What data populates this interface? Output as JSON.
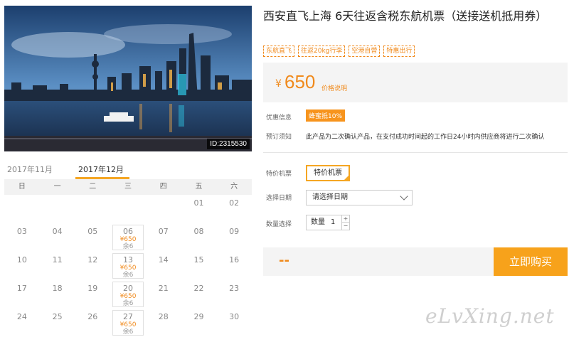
{
  "photo": {
    "id_label": "ID:2315530"
  },
  "calendar": {
    "tabs": [
      "2017年11月",
      "2017年12月"
    ],
    "active_tab": 1,
    "weekdays": [
      "日",
      "一",
      "二",
      "三",
      "四",
      "五",
      "六"
    ],
    "weeks": [
      [
        {
          "d": ""
        },
        {
          "d": ""
        },
        {
          "d": ""
        },
        {
          "d": ""
        },
        {
          "d": ""
        },
        {
          "d": "01"
        },
        {
          "d": "02"
        }
      ],
      [
        {
          "d": "03"
        },
        {
          "d": "04"
        },
        {
          "d": "05"
        },
        {
          "d": "06",
          "price": "¥650",
          "remain": "余6"
        },
        {
          "d": "07"
        },
        {
          "d": "08"
        },
        {
          "d": "09"
        }
      ],
      [
        {
          "d": "10"
        },
        {
          "d": "11"
        },
        {
          "d": "12"
        },
        {
          "d": "13",
          "price": "¥650",
          "remain": "余6"
        },
        {
          "d": "14"
        },
        {
          "d": "15"
        },
        {
          "d": "16"
        }
      ],
      [
        {
          "d": "17"
        },
        {
          "d": "18"
        },
        {
          "d": "19"
        },
        {
          "d": "20",
          "price": "¥650",
          "remain": "余6"
        },
        {
          "d": "21"
        },
        {
          "d": "22"
        },
        {
          "d": "23"
        }
      ],
      [
        {
          "d": "24"
        },
        {
          "d": "25"
        },
        {
          "d": "26"
        },
        {
          "d": "27",
          "price": "¥650",
          "remain": "余6"
        },
        {
          "d": "28"
        },
        {
          "d": "29"
        },
        {
          "d": "30"
        }
      ]
    ]
  },
  "product": {
    "title": "西安直飞上海 6天往返含税东航机票（送接送机抵用券）",
    "tags": [
      "东航直飞",
      "往返20kg行李",
      "空港自营",
      "特惠出行"
    ],
    "price_symbol": "¥",
    "price": "650",
    "price_note": "价格说明",
    "promo_label": "优惠信息",
    "promo_badge": "蜂蜜抵10%",
    "notice_label": "预订须知",
    "notice_text": "此产品为二次确认产品，在支付成功时间起的工作日24小时内供应商将进行二次确认",
    "option_label": "特价机票",
    "option_value": "特价机票",
    "date_label": "选择日期",
    "date_placeholder": "请选择日期",
    "qty_label": "数量选择",
    "qty_prefix": "数量",
    "qty_value": "1",
    "qty_plus": "+",
    "qty_minus": "−",
    "total": "--",
    "buy_label": "立即购买"
  },
  "watermark": "eLvXing.net",
  "colors": {
    "accent": "#f08a1c",
    "button": "#f7a21b",
    "tab_underline": "#f5a623"
  }
}
